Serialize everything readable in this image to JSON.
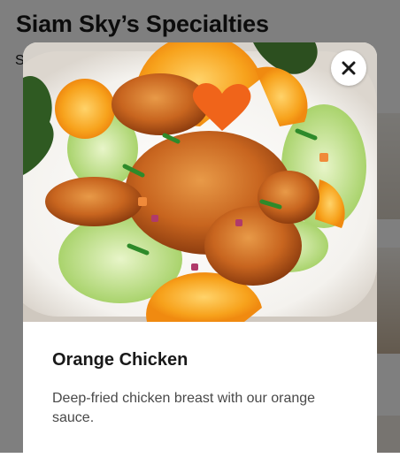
{
  "background": {
    "title": "Siam Sky’s Specialties",
    "subtext": "S"
  },
  "modal": {
    "close_icon": "close-icon",
    "image_alt": "Orange Chicken dish photo",
    "item_name": "Orange Chicken",
    "description": "Deep-fried chicken breast with our orange sauce."
  },
  "colors": {
    "overlay": "rgba(0,0,0,0.50)",
    "title_text": "#191919",
    "body_text": "#494949",
    "orange": "#f39a1e"
  }
}
